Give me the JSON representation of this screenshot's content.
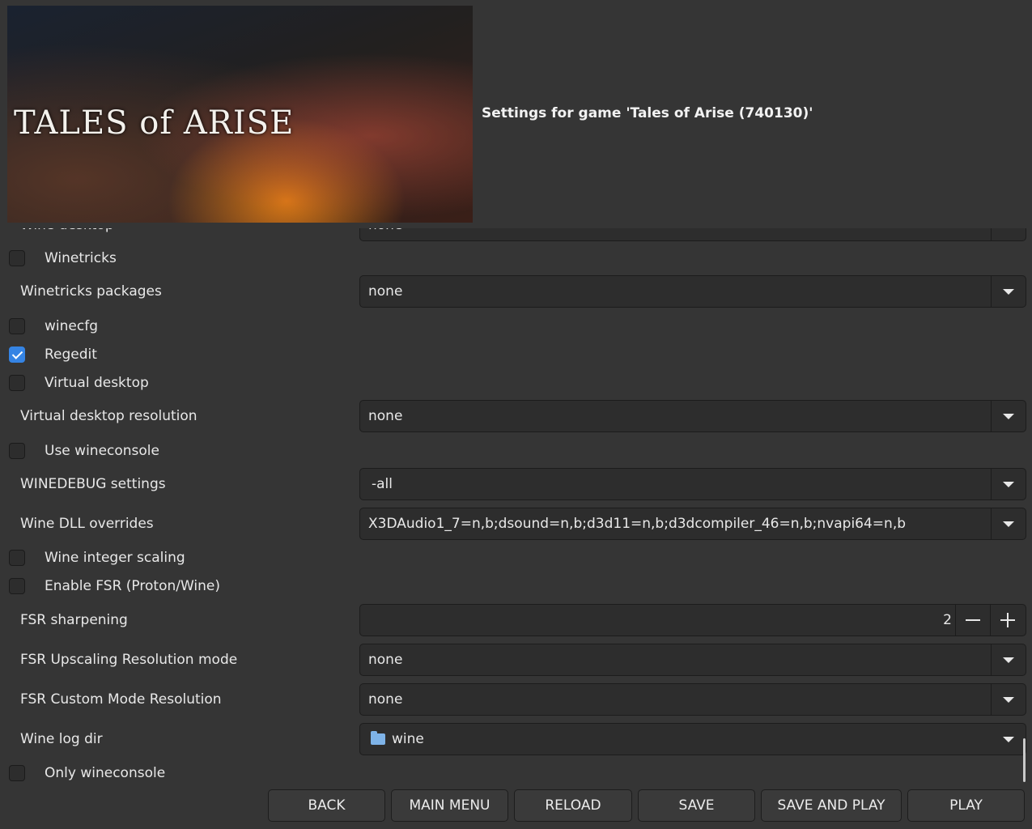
{
  "header": {
    "title": "Settings for game 'Tales of Arise (740130)'",
    "banner_logo": "TALES of ARISE"
  },
  "settings": {
    "partial_top_label": "Wine desktop",
    "partial_top_value": "none",
    "winetricks_label": "Winetricks",
    "winetricks_checked": false,
    "winetricks_packages_label": "Winetricks packages",
    "winetricks_packages_value": "none",
    "winecfg_label": "winecfg",
    "winecfg_checked": false,
    "regedit_label": "Regedit",
    "regedit_checked": true,
    "virtual_desktop_label": "Virtual desktop",
    "virtual_desktop_checked": false,
    "virtual_desktop_resolution_label": "Virtual desktop resolution",
    "virtual_desktop_resolution_value": "none",
    "use_wineconsole_label": "Use wineconsole",
    "use_wineconsole_checked": false,
    "winedebug_label": "WINEDEBUG settings",
    "winedebug_value": "-all",
    "dll_overrides_label": "Wine DLL overrides",
    "dll_overrides_value": "X3DAudio1_7=n,b;dsound=n,b;d3d11=n,b;d3dcompiler_46=n,b;nvapi64=n,b",
    "integer_scaling_label": "Wine integer scaling",
    "integer_scaling_checked": false,
    "enable_fsr_label": "Enable FSR (Proton/Wine)",
    "enable_fsr_checked": false,
    "fsr_sharpening_label": "FSR sharpening",
    "fsr_sharpening_value": "2",
    "fsr_upscaling_label": "FSR Upscaling Resolution mode",
    "fsr_upscaling_value": "none",
    "fsr_custom_label": "FSR Custom Mode Resolution",
    "fsr_custom_value": "none",
    "wine_log_dir_label": "Wine log dir",
    "wine_log_dir_value": "wine",
    "only_wineconsole_label": "Only wineconsole",
    "only_wineconsole_checked": false
  },
  "footer": {
    "back": "BACK",
    "main_menu": "MAIN MENU",
    "reload": "RELOAD",
    "save": "SAVE",
    "save_and_play": "SAVE AND PLAY",
    "play": "PLAY"
  },
  "colors": {
    "background": "#353535",
    "field": "#2d2d2d",
    "accent": "#3584e4",
    "folder": "#7eb3e8"
  }
}
